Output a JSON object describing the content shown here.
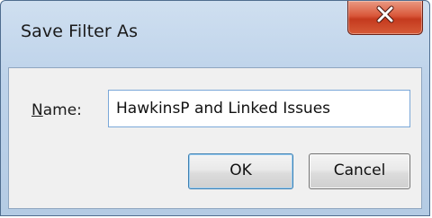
{
  "dialog": {
    "title": "Save Filter As",
    "close_icon": "close-icon",
    "name_label_accel": "N",
    "name_label_rest": "ame:",
    "name_value": "HawkinsP and Linked Issues",
    "ok_label": "OK",
    "cancel_label": "Cancel"
  },
  "colors": {
    "close_button": "#c9432a",
    "titlebar": "#bfd3ea",
    "client": "#f0f0f0",
    "focus_border": "#3c7fb1"
  }
}
